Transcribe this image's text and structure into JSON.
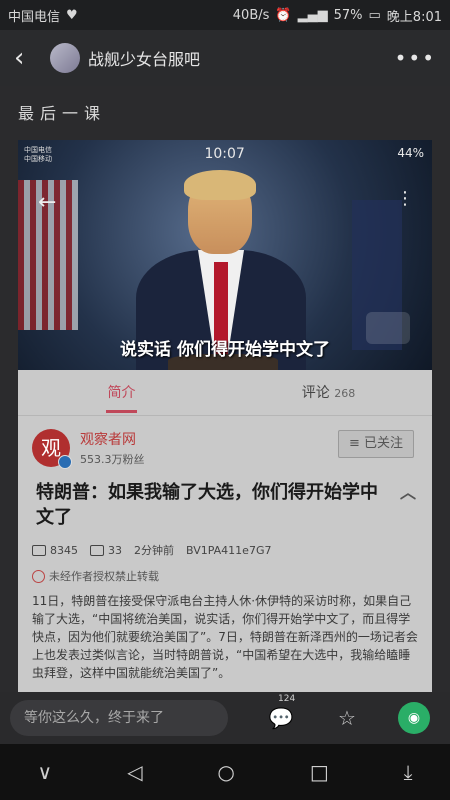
{
  "status": {
    "carrier": "中国电信",
    "speed": "40B/s",
    "battery": "57%",
    "time": "晚上8:01"
  },
  "appbar": {
    "title": "战舰少女台服吧"
  },
  "post": {
    "title": "最后一课"
  },
  "video": {
    "carrier_line1": "中国电信",
    "carrier_line2": "中国移动",
    "time": "10:07",
    "battery": "44%",
    "subtitle": "说实话 你们得开始学中文了"
  },
  "tabs": [
    {
      "label": "简介"
    },
    {
      "label": "评论",
      "count": "268"
    }
  ],
  "author": {
    "name": "观察者网",
    "fans": "553.3万粉丝",
    "follow_label": "已关注"
  },
  "article": {
    "headline": "特朗普：如果我输了大选，你们得开始学中文了",
    "plays": "8345",
    "comments": "33",
    "time_ago": "2分钟前",
    "bv": "BV1PA411e7G7",
    "notice": "未经作者授权禁止转载",
    "body": "11日，特朗普在接受保守派电台主持人休·休伊特的采访时称，如果自己输了大选，“中国将统治美国，说实话，你们得开始学中文了，而且得学快点，因为他们就要统治美国了”。7日，特朗普在新泽西州的一场记者会上也发表过类似言论，当时特朗普说，“中国希望在大选中，我输给瞌睡虫拜登，这样中国就能统治美国了”。"
  },
  "bottom": {
    "placeholder": "等你这么久，终于来了",
    "comment_count": "124"
  }
}
